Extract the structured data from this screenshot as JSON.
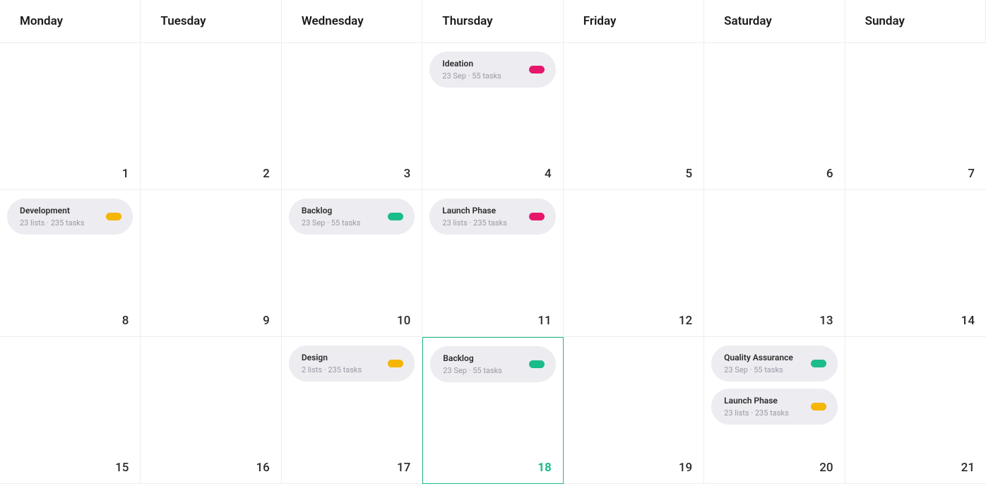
{
  "days_of_week": [
    "Monday",
    "Tuesday",
    "Wednesday",
    "Thursday",
    "Friday",
    "Saturday",
    "Sunday"
  ],
  "colors": {
    "yellow": "#f5b500",
    "green": "#1abc8b",
    "pink": "#e6176b"
  },
  "weeks": [
    {
      "days": [
        {
          "num": "1",
          "events": []
        },
        {
          "num": "2",
          "events": []
        },
        {
          "num": "3",
          "events": []
        },
        {
          "num": "4",
          "events": [
            {
              "title": "Ideation",
              "meta": "23 Sep  ·  55 tasks",
              "color": "pink"
            }
          ]
        },
        {
          "num": "5",
          "events": []
        },
        {
          "num": "6",
          "events": []
        },
        {
          "num": "7",
          "events": []
        }
      ]
    },
    {
      "days": [
        {
          "num": "8",
          "events": [
            {
              "title": "Development",
              "meta": "23 lists  ·  235 tasks",
              "color": "yellow"
            }
          ]
        },
        {
          "num": "9",
          "events": []
        },
        {
          "num": "10",
          "events": [
            {
              "title": "Backlog",
              "meta": "23 Sep  ·  55 tasks",
              "color": "green"
            }
          ]
        },
        {
          "num": "11",
          "events": [
            {
              "title": "Launch Phase",
              "meta": "23 lists  ·  235 tasks",
              "color": "pink"
            }
          ]
        },
        {
          "num": "12",
          "events": []
        },
        {
          "num": "13",
          "events": []
        },
        {
          "num": "14",
          "events": []
        }
      ]
    },
    {
      "days": [
        {
          "num": "15",
          "events": []
        },
        {
          "num": "16",
          "events": []
        },
        {
          "num": "17",
          "events": [
            {
              "title": "Design",
              "meta": "2 lists  ·  235 tasks",
              "color": "yellow"
            }
          ]
        },
        {
          "num": "18",
          "today": true,
          "events": [
            {
              "title": "Backlog",
              "meta": "23 Sep  ·  55 tasks",
              "color": "green"
            }
          ]
        },
        {
          "num": "19",
          "events": []
        },
        {
          "num": "20",
          "events": [
            {
              "title": "Quality Assurance",
              "meta": "23 Sep  ·  55 tasks",
              "color": "green"
            },
            {
              "title": "Launch Phase",
              "meta": "23 lists  ·  235 tasks",
              "color": "yellow"
            }
          ]
        },
        {
          "num": "21",
          "events": []
        }
      ]
    }
  ]
}
